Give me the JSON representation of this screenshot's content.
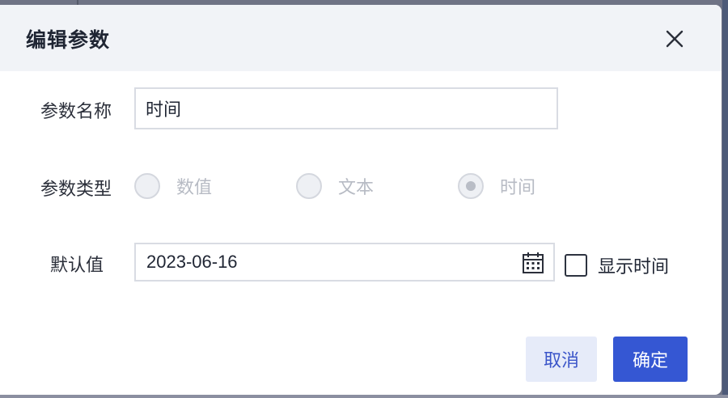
{
  "dialog": {
    "title": "编辑参数",
    "close_icon": "close-icon"
  },
  "form": {
    "name_label": "参数名称",
    "name_value": "时间",
    "type_label": "参数类型",
    "type_options": [
      {
        "label": "数值",
        "selected": false
      },
      {
        "label": "文本",
        "selected": false
      },
      {
        "label": "时间",
        "selected": true
      }
    ],
    "default_label": "默认值",
    "default_value": "2023-06-16",
    "calendar_icon": "calendar-icon",
    "show_time_label": "显示时间",
    "show_time_checked": false
  },
  "buttons": {
    "cancel_label": "取消",
    "ok_label": "确定"
  },
  "colors": {
    "primary": "#3557d3",
    "header_bg": "#f1f3f7",
    "overlay": "#6e7284"
  }
}
